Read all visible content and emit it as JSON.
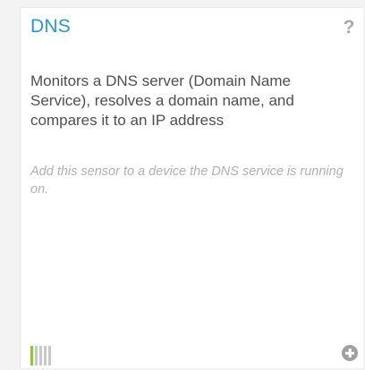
{
  "sensor": {
    "title": "DNS",
    "help_glyph": "?",
    "description": "Monitors a DNS server (Domain Name Service), resolves a domain name, and compares it to an IP address",
    "hint": "Add this sensor to a device the DNS service is running on.",
    "priority": {
      "level": 1,
      "max": 5
    },
    "colors": {
      "title": "#2a97d4",
      "priority_active": "#8cc63f",
      "priority_inactive": "#c8c8c8"
    },
    "icons": {
      "help": "help-question-icon",
      "add": "add-circle-icon"
    }
  }
}
